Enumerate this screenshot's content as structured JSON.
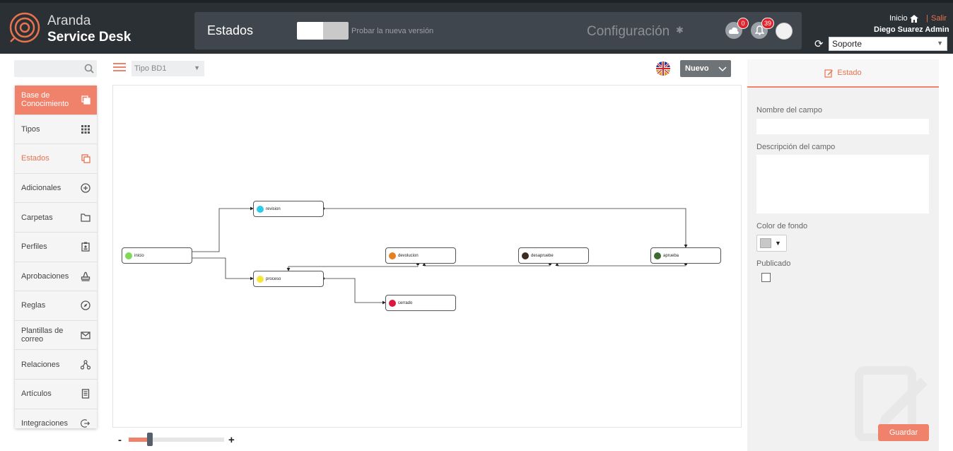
{
  "app": {
    "brand_line1": "Aranda",
    "brand_line2": "Service Desk",
    "page_title": "Estados",
    "try_new_version": "Probar la nueva versión",
    "config_title": "Configuración",
    "cloud_badge": "0",
    "bell_badge": "39",
    "home_label": "Inicio",
    "separator": "|",
    "logout_label": "Salir",
    "user_name": "Diego Suarez Admin",
    "project_selected": "Soporte",
    "accent_color": "#f0816a"
  },
  "sidebar": {
    "search_placeholder": "",
    "items": [
      {
        "label": "Base de Conocimiento",
        "icon": "copy-icon"
      },
      {
        "label": "Tipos",
        "icon": "grid-icon"
      },
      {
        "label": "Estados",
        "icon": "copy-icon"
      },
      {
        "label": "Adicionales",
        "icon": "plus-circle-icon"
      },
      {
        "label": "Carpetas",
        "icon": "folder-icon"
      },
      {
        "label": "Perfiles",
        "icon": "id-badge-icon"
      },
      {
        "label": "Aprobaciones",
        "icon": "stamp-icon"
      },
      {
        "label": "Reglas",
        "icon": "compass-icon"
      },
      {
        "label": "Plantillas de correo",
        "icon": "mail-icon"
      },
      {
        "label": "Relaciones",
        "icon": "relations-icon"
      },
      {
        "label": "Artículos",
        "icon": "article-icon"
      },
      {
        "label": "Integraciones",
        "icon": "integration-icon"
      }
    ]
  },
  "toolbar": {
    "type_selected": "Tipo BD1",
    "new_label": "Nuevo"
  },
  "diagram": {
    "nodes": [
      {
        "id": "inicio",
        "label": "inicio",
        "color": "#7ed957"
      },
      {
        "id": "revision",
        "label": "revision",
        "color": "#2ecbe9"
      },
      {
        "id": "proceso",
        "label": "proceso",
        "color": "#f5e63c"
      },
      {
        "id": "devolucion",
        "label": "devolucion",
        "color": "#e67e22"
      },
      {
        "id": "cerrado",
        "label": "cerrado",
        "color": "#d81b3c"
      },
      {
        "id": "desapruebe",
        "label": "desapruebe",
        "color": "#3d2b1f"
      },
      {
        "id": "aprueba",
        "label": "aprueba",
        "color": "#3e6b2e"
      }
    ]
  },
  "zoom": {
    "level": 0.22
  },
  "panel": {
    "tab_label": "Estado",
    "field_name_label": "Nombre del campo",
    "field_name_value": "",
    "field_desc_label": "Descripción del campo",
    "field_desc_value": "",
    "bg_color_label": "Color de fondo",
    "bg_color_value": "#c8c8c8",
    "published_label": "Publicado",
    "published": false,
    "save_label": "Guardar"
  }
}
